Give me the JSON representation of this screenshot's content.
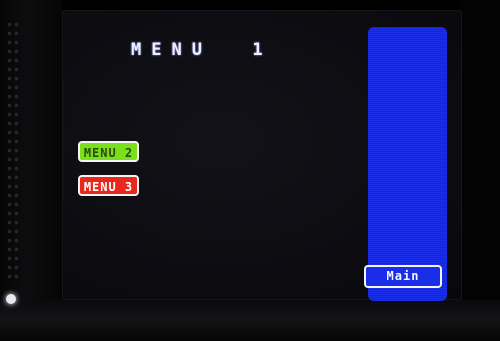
{
  "screen": {
    "title": "MENU  1"
  },
  "buttons": {
    "menu2_label": "MENU 2",
    "menu3_label": "MENU 3",
    "main_label": "Main"
  },
  "colors": {
    "menu2_bg": "#7be01c",
    "menu3_bg": "#e8281c",
    "side_panel": "#1a2ee8",
    "screen_bg": "#0b0b10"
  }
}
